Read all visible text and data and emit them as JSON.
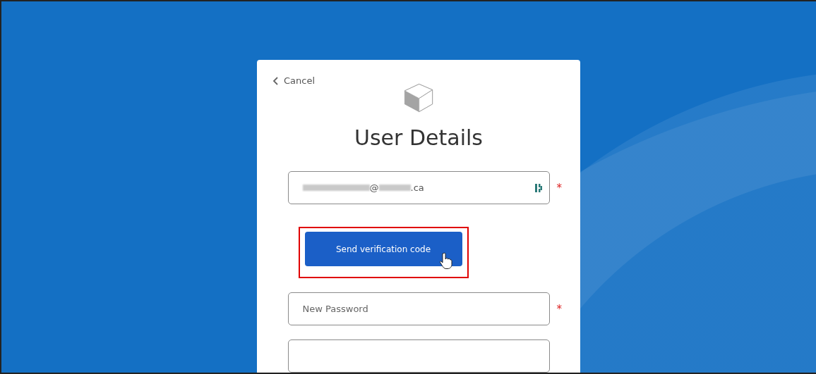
{
  "cancel_link": {
    "label": "Cancel"
  },
  "title": "User Details",
  "fields": [
    {
      "kind": "email",
      "required_mark": "*",
      "value_parts": [
        {
          "kind": "redacted"
        },
        {
          "kind": "text",
          "text": "@"
        },
        {
          "kind": "redacted"
        },
        {
          "kind": "text",
          "text": ".ca"
        }
      ]
    },
    {
      "kind": "action",
      "label": "Send verification code",
      "highlighted": true
    },
    {
      "kind": "password",
      "required_mark": "*",
      "placeholder": "New Password"
    },
    {
      "kind": "password"
    }
  ]
}
